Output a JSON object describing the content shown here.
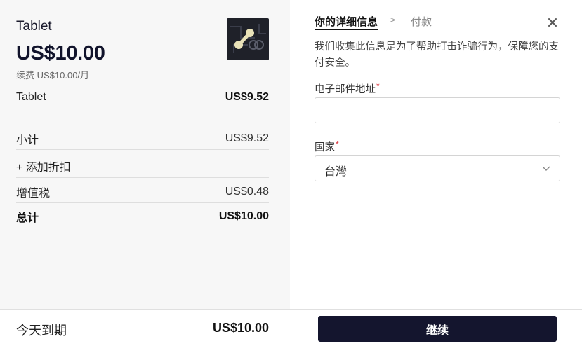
{
  "summary": {
    "product_name": "Tablet",
    "price": "US$10.00",
    "renewal": "续费 US$10.00/月",
    "thumbnail_icon": "link-icon",
    "line_item": {
      "label": "Tablet",
      "amount": "US$9.52"
    },
    "subtotal": {
      "label": "小计",
      "amount": "US$9.52"
    },
    "discount_link": "+ 添加折扣",
    "tax": {
      "label": "增值税",
      "amount": "US$0.48"
    },
    "total": {
      "label": "总计",
      "amount": "US$10.00"
    }
  },
  "footer": {
    "due_label": "今天到期",
    "due_amount": "US$10.00",
    "continue_label": "继续"
  },
  "steps": {
    "active": "你的详细信息",
    "separator": ">",
    "next": "付款"
  },
  "form": {
    "intro": "我们收集此信息是为了帮助打击诈骗行为，保障您的支付安全。",
    "email_label": "电子邮件地址",
    "email_value": "",
    "email_placeholder": "",
    "country_label": "国家",
    "country_value": "台灣",
    "required_mark": "*"
  },
  "colors": {
    "primary_button": "#14152e",
    "panel_bg": "#f7f7f7",
    "required": "#d9363e"
  }
}
